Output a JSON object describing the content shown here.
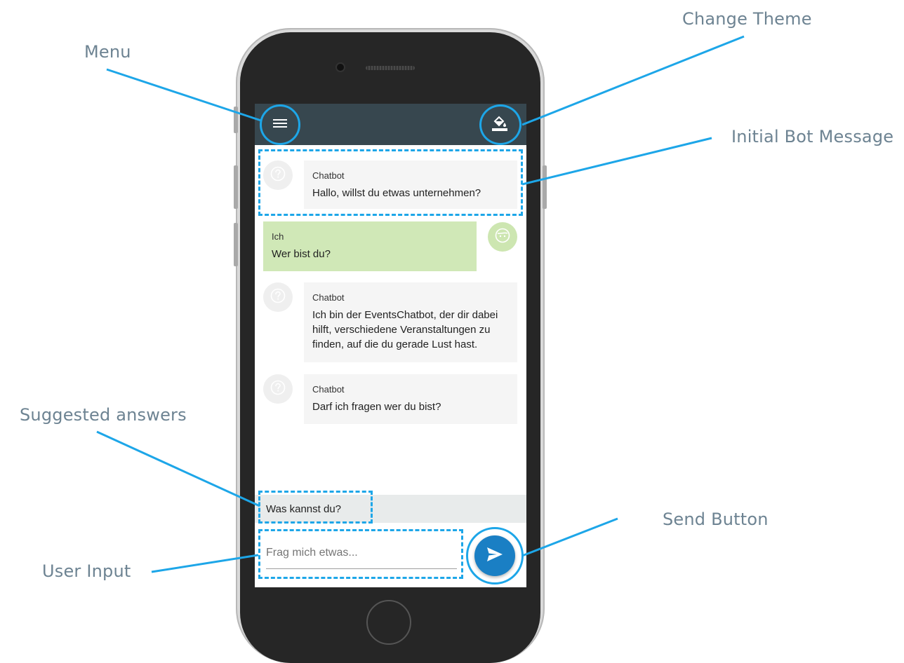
{
  "annotations": {
    "menu": "Menu",
    "change_theme": "Change Theme",
    "initial_bot_message": "Initial Bot Message",
    "suggested_answers": "Suggested answers",
    "send_button": "Send Button",
    "user_input": "User Input"
  },
  "app": {
    "menu_icon": "hamburger-menu-icon",
    "theme_icon": "paint-bucket-icon"
  },
  "messages": [
    {
      "author": "Chatbot",
      "text": "Hallo, willst du etwas unternehmen?",
      "sender": "bot"
    },
    {
      "author": "Ich",
      "text": "Wer bist du?",
      "sender": "user"
    },
    {
      "author": "Chatbot",
      "text": "Ich bin der EventsChatbot, der dir dabei hilft, verschiedene Veranstaltungen zu finden, auf die du gerade Lust hast.",
      "sender": "bot"
    },
    {
      "author": "Chatbot",
      "text": "Darf ich fragen wer du bist?",
      "sender": "bot"
    }
  ],
  "suggestions": [
    "Was kannst du?"
  ],
  "input": {
    "placeholder": "Frag mich etwas...",
    "value": ""
  },
  "colors": {
    "appbar": "#37474f",
    "highlight": "#1da6e8",
    "send_button": "#1a7fc4",
    "user_bubble": "#d0e8b7",
    "bot_bubble": "#f5f5f5"
  }
}
